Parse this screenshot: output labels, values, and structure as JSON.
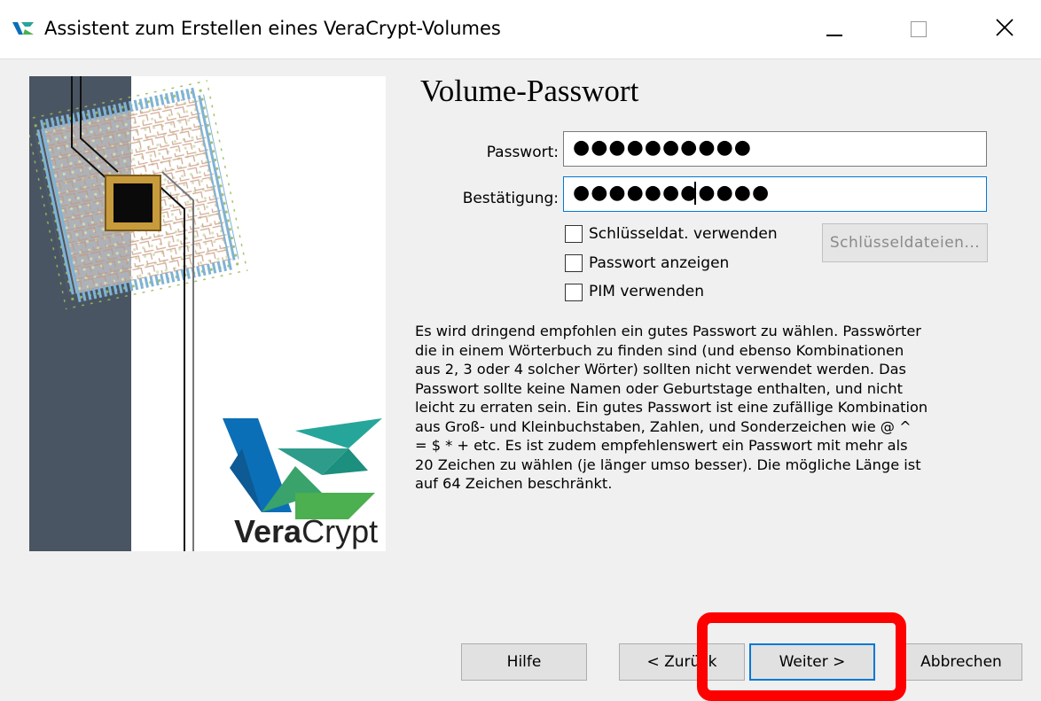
{
  "window": {
    "title": "Assistent zum Erstellen eines VeraCrypt-Volumes"
  },
  "brand": {
    "logo_text_bold": "Vera",
    "logo_text_regular": "Crypt",
    "logo_colors": [
      "#0b6fb8",
      "#26a69a",
      "#4caf50"
    ]
  },
  "page": {
    "title": "Volume-Passwort",
    "password_label": "Passwort:",
    "password_value": "●●●●●●●●●●",
    "confirm_label": "Bestätigung:",
    "confirm_value": "●●●●●●●●●●●",
    "use_keyfiles_label": "Schlüsseldat. verwenden",
    "show_password_label": "Passwort anzeigen",
    "use_pim_label": "PIM verwenden",
    "keyfiles_button": "Schlüsseldateien...",
    "info_text": "Es wird dringend empfohlen ein gutes Passwort zu wählen. Passwörter\ndie in einem Wörterbuch zu finden sind (und ebenso Kombinationen\naus 2, 3 oder 4 solcher Wörter) sollten nicht verwendet werden. Das\nPasswort sollte keine Namen oder Geburtstage enthalten, und nicht\nleicht zu erraten sein. Ein gutes Passwort ist eine zufällige Kombination\naus Groß- und Kleinbuchstaben, Zahlen, und Sonderzeichen wie @ ^\n= $ * + etc. Es ist zudem empfehlenswert ein Passwort mit mehr als\n20 Zeichen zu wählen (je länger umso besser). Die mögliche Länge ist\nauf 64 Zeichen beschränkt."
  },
  "buttons": {
    "help": "Hilfe",
    "back": "< Zurück",
    "next": "Weiter >",
    "cancel": "Abbrechen"
  },
  "annotation": {
    "highlight_color": "#ff0000"
  }
}
